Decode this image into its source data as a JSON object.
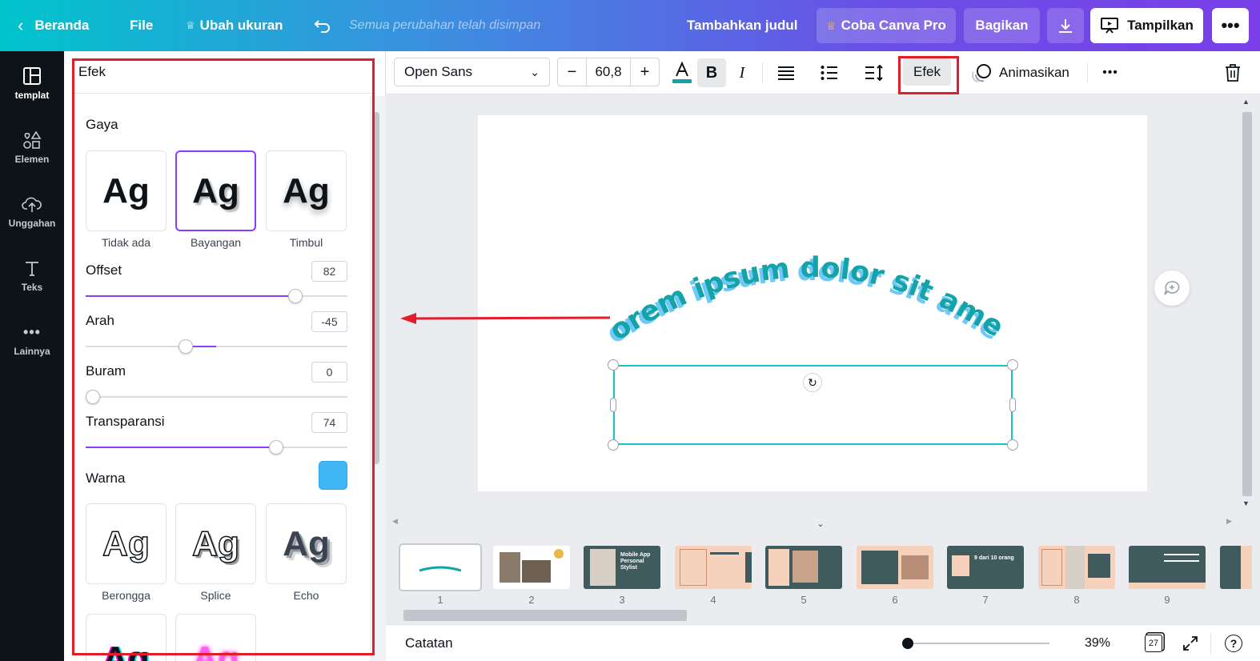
{
  "topbar": {
    "home_label": "Beranda",
    "file_label": "File",
    "resize_label": "Ubah ukuran",
    "saved_status": "Semua perubahan telah disimpan",
    "add_title_label": "Tambahkan judul",
    "try_pro_label": "Coba Canva Pro",
    "share_label": "Bagikan",
    "present_label": "Tampilkan"
  },
  "rail": {
    "items": [
      {
        "label": "templat",
        "icon": "template-icon"
      },
      {
        "label": "Elemen",
        "icon": "elements-icon"
      },
      {
        "label": "Unggahan",
        "icon": "upload-cloud-icon"
      },
      {
        "label": "Teks",
        "icon": "text-icon"
      },
      {
        "label": "Lainnya",
        "icon": "more-dots-icon"
      }
    ]
  },
  "panel": {
    "title": "Efek",
    "style_section": "Gaya",
    "styles": [
      {
        "label": "Tidak ada",
        "sample": "Ag"
      },
      {
        "label": "Bayangan",
        "sample": "Ag"
      },
      {
        "label": "Timbul",
        "sample": "Ag"
      },
      {
        "label": "Berongga",
        "sample": "Ag"
      },
      {
        "label": "Splice",
        "sample": "Ag"
      },
      {
        "label": "Echo",
        "sample": "Ag"
      },
      {
        "label": "",
        "sample": "Ag"
      },
      {
        "label": "",
        "sample": "Ag"
      }
    ],
    "selected_style": "Bayangan",
    "controls": [
      {
        "label": "Offset",
        "value": "82",
        "level": 0.82
      },
      {
        "label": "Arah",
        "value": "-45",
        "level": 0.375
      },
      {
        "label": "Buram",
        "value": "0",
        "level": 0
      },
      {
        "label": "Transparansi",
        "value": "74",
        "level": 0.74
      }
    ],
    "color_label": "Warna",
    "color_value": "#41b6f5"
  },
  "toolbar": {
    "font_name": "Open Sans",
    "font_size": "60,8",
    "minus": "−",
    "plus": "+",
    "effects_label": "Efek",
    "animate_label": "Animasikan",
    "text_color": "#13a3a8"
  },
  "canvas": {
    "text": "Lorem ipsum dolor sit amet,",
    "text_color": "#13a3a8",
    "shadow_color": "#41b6f5"
  },
  "thumbnails": {
    "pages": [
      "1",
      "2",
      "3",
      "4",
      "5",
      "6",
      "7",
      "8",
      "9"
    ],
    "t3_title": "Mobile App Personal Stylist",
    "t7_title": "9 dari 10 orang"
  },
  "bottombar": {
    "notes_label": "Catatan",
    "zoom": "39%",
    "page_count": "27",
    "help": "?"
  },
  "colors": {
    "accent": "#8b3dff",
    "highlight": "#e11d2a",
    "selection": "#13c4cc"
  }
}
